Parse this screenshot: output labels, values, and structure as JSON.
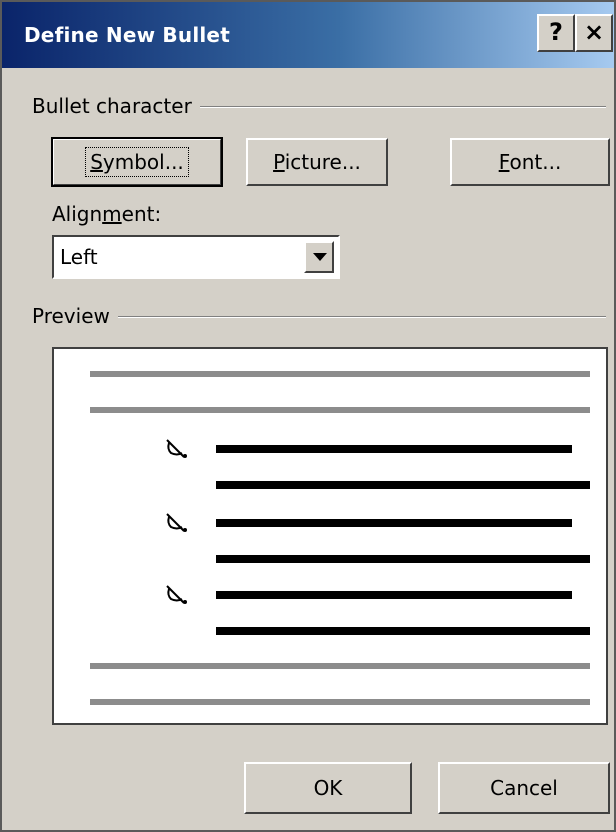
{
  "dialog": {
    "title": "Define New Bullet",
    "help_button": "?",
    "close_button": "×"
  },
  "bullet_character": {
    "section_label": "Bullet character",
    "symbol_button": {
      "underline_char": "S",
      "rest": "ymbol..."
    },
    "picture_button": {
      "underline_char": "P",
      "rest": "icture..."
    },
    "font_button": {
      "underline_char": "F",
      "rest": "ont..."
    }
  },
  "alignment": {
    "label_prefix": "Align",
    "label_underline": "m",
    "label_suffix": "ent:",
    "selected": "Left"
  },
  "preview": {
    "section_label": "Preview",
    "bullet_count": 3,
    "bullet_icon": "crossed-circle-symbol-icon"
  },
  "footer": {
    "ok_label": "OK",
    "cancel_label": "Cancel"
  },
  "colors": {
    "title_gradient_start": "#0a246a",
    "title_gradient_end": "#a6caf0",
    "dialog_bg": "#d4d0c8",
    "preview_gray_line": "#8c8c8c"
  }
}
